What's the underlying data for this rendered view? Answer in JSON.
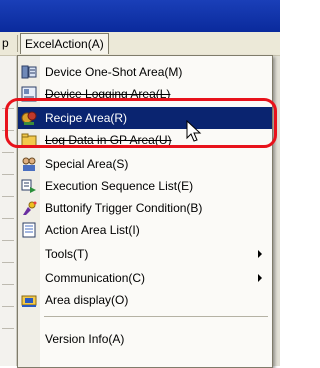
{
  "menubar": {
    "left_fragment": "p",
    "menu_title": "ExcelAction(A)"
  },
  "menu_items": [
    {
      "label": "Device One-Shot Area(M)",
      "icon": "device-oneshot-icon",
      "submenu": false
    },
    {
      "label": "Device Logging Area(L)",
      "icon": "device-logging-icon",
      "submenu": false
    },
    {
      "label": "Recipe Area(R)",
      "icon": "recipe-icon",
      "submenu": false,
      "selected": true
    },
    {
      "label": "Log Data in GP Area(U)",
      "icon": "log-data-icon",
      "submenu": false
    },
    {
      "label": "Special Area(S)",
      "icon": "special-area-icon",
      "submenu": false
    },
    {
      "label": "Execution Sequence List(E)",
      "icon": "execution-sequence-icon",
      "submenu": false
    },
    {
      "label": "Buttonify Trigger Condition(B)",
      "icon": "buttonify-icon",
      "submenu": false
    },
    {
      "label": "Action Area List(I)",
      "icon": "action-area-list-icon",
      "submenu": false
    },
    {
      "label": "Tools(T)",
      "icon": "",
      "submenu": true
    },
    {
      "label": "Communication(C)",
      "icon": "",
      "submenu": true
    },
    {
      "label": "Area display(O)",
      "icon": "area-display-icon",
      "submenu": false
    },
    {
      "label": "Version Info(A)",
      "icon": "",
      "submenu": false
    }
  ],
  "colors": {
    "selection": "#0a2470",
    "highlight_ring": "#e8121b",
    "titlebar": "#0a2a9c"
  }
}
